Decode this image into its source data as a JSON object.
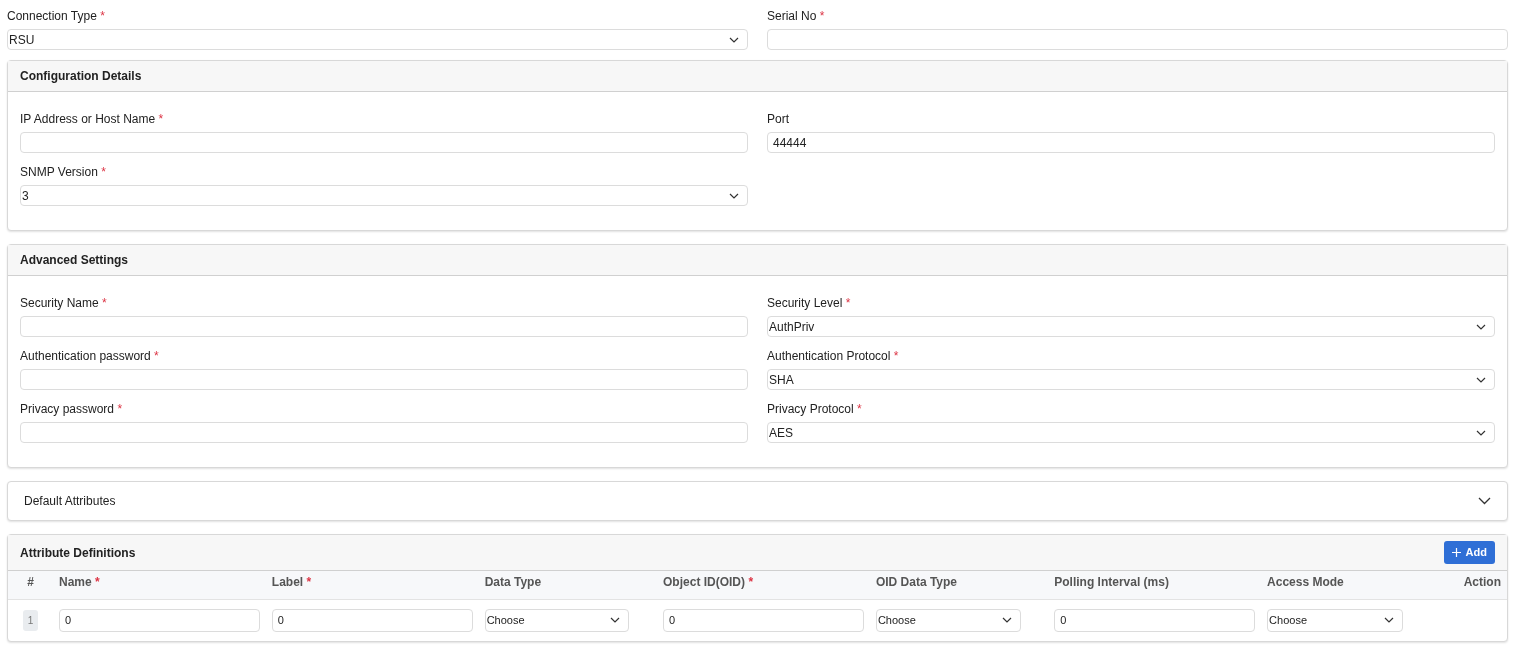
{
  "top_fields": [
    {
      "kind": "select",
      "label": "Connection Type",
      "required_mark": "*",
      "value": "RSU"
    },
    {
      "kind": "text",
      "label": "Serial No",
      "required_mark": "*"
    }
  ],
  "sections": [
    {
      "title": "Configuration Details",
      "fields": [
        {
          "kind": "text",
          "label": "IP Address or Host Name",
          "required_mark": "*"
        },
        {
          "kind": "text",
          "label": "Port",
          "value": "44444"
        },
        {
          "kind": "select",
          "label": "SNMP Version",
          "required_mark": "*",
          "value": "3"
        }
      ]
    },
    {
      "title": "Advanced Settings",
      "fields": [
        {
          "kind": "text",
          "label": "Security Name",
          "required_mark": "*"
        },
        {
          "kind": "select",
          "label": "Security Level",
          "required_mark": "*",
          "value": "AuthPriv"
        },
        {
          "kind": "text",
          "label": "Authentication password",
          "required_mark": "*"
        },
        {
          "kind": "select",
          "label": "Authentication Protocol",
          "required_mark": "*",
          "value": "SHA"
        },
        {
          "kind": "text",
          "label": "Privacy password",
          "required_mark": "*"
        },
        {
          "kind": "select",
          "label": "Privacy Protocol",
          "required_mark": "*",
          "value": "AES"
        }
      ]
    }
  ],
  "default_attributes": {
    "title": "Default Attributes",
    "expanded": false
  },
  "attribute_definitions": {
    "title": "Attribute Definitions",
    "add_button": "Add",
    "columns": [
      {
        "label": "#"
      },
      {
        "label": "Name",
        "required_mark": "*"
      },
      {
        "label": "Label",
        "required_mark": "*"
      },
      {
        "label": "Data Type"
      },
      {
        "label": "Object ID(OID)",
        "required_mark": "*"
      },
      {
        "label": "OID Data Type"
      },
      {
        "label": "Polling Interval (ms)"
      },
      {
        "label": "Access Mode"
      },
      {
        "label": "Action"
      }
    ],
    "rows": [
      {
        "cells": [
          {
            "kind": "index",
            "value": "1"
          },
          {
            "kind": "text",
            "value": "0"
          },
          {
            "kind": "text",
            "value": "0"
          },
          {
            "kind": "select",
            "value": "Choose"
          },
          {
            "kind": "text",
            "value": "0"
          },
          {
            "kind": "select",
            "value": "Choose"
          },
          {
            "kind": "text",
            "value": "0"
          },
          {
            "kind": "select",
            "value": "Choose"
          }
        ]
      }
    ]
  }
}
